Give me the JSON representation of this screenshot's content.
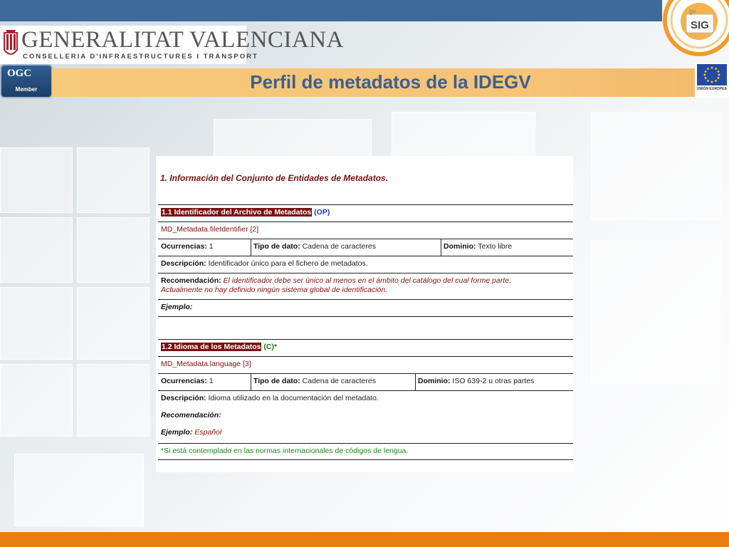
{
  "header": {
    "gva_title": "GENERALITAT VALENCIANA",
    "gva_subtitle": "CONSELLERIA D'INFRAESTRUCTURES I TRANSPORT",
    "slide_title": "Perfil de metadatos de la IDEGV",
    "ogc_label": "OGC",
    "ogc_member": "Member",
    "ue_text": "UNIÓN EUROPEA",
    "gvsig_top": "gv",
    "gvsig_main": "SIG"
  },
  "doc": {
    "heading": "1. Información del Conjunto de Entidades de Metadatos.",
    "sections": [
      {
        "title": "1.1 Identificador del Archivo de Metadatos",
        "tag": "(OP)",
        "path": "MD_Metadata.fileIdentifier [2]",
        "ocurrencias_label": "Ocurrencias:",
        "ocurrencias_value": "1",
        "tipo_label": "Tipo de dato:",
        "tipo_value": "Cadena de caracteres",
        "dominio_label": "Dominio:",
        "dominio_value": "Texto libre",
        "descripcion_label": "Descripción:",
        "descripcion_value": "Identificador único para el fichero de metadatos.",
        "recomendacion_label": "Recomendación:",
        "recomendacion_value": "El identificador debe ser único al menos en el ámbito del catálogo del cual forme parte.",
        "recomendacion_value2": "Actualmente no hay definido ningún sistema global de identificación.",
        "ejemplo_label": "Ejemplo:",
        "ejemplo_value": ""
      },
      {
        "title": "1.2 Idioma de los Metadatos",
        "tag": "(C)*",
        "path": "MD_Metadata.language [3]",
        "ocurrencias_label": "Ocurrencias:",
        "ocurrencias_value": "1",
        "tipo_label": "Tipo de dato:",
        "tipo_value": "Cadena de caracteres",
        "dominio_label": "Dominio:",
        "dominio_value": "ISO 639-2 u otras partes",
        "descripcion_label": "Descripción:",
        "descripcion_value": "Idioma utilizado en la documentación del metadato.",
        "recomendacion_label": "Recomendación:",
        "ejemplo_label": "Ejemplo:",
        "ejemplo_value": "Español",
        "nota": "*Si está contemplado en las normas internacionales de códigos de lengua."
      }
    ]
  },
  "colors": {
    "top_bar": "#3d6a98",
    "title_band": "#f6c377",
    "title_text": "#3b5f93",
    "bottom_bar": "#e87e0f",
    "maroon": "#7a1010"
  }
}
